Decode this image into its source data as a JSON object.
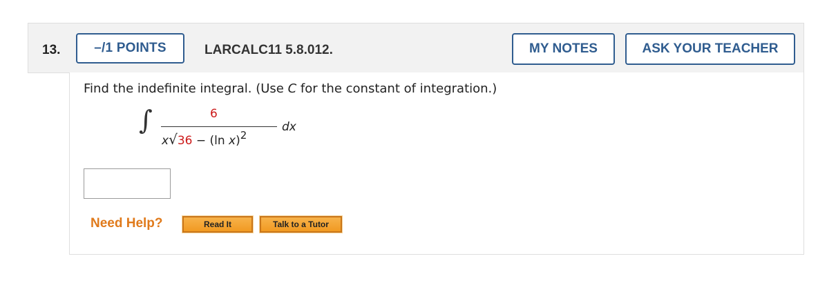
{
  "question": {
    "number": "13.",
    "points_label": "–/1 POINTS",
    "problem_id": "LARCALC11 5.8.012.",
    "my_notes_label": "MY NOTES",
    "ask_teacher_label": "ASK YOUR TEACHER"
  },
  "body": {
    "prompt_before": "Find the indefinite integral. (Use ",
    "prompt_var": "C",
    "prompt_after": " for the constant of integration.)",
    "integral": {
      "sign": "∫",
      "numerator": "6",
      "denom_x": "x",
      "radical": "√",
      "denom_const": "36",
      "denom_minus": " − (ln ",
      "denom_x2": "x",
      "denom_close": ")",
      "exponent": "2",
      "differential": "dx"
    },
    "answer_value": ""
  },
  "help": {
    "label": "Need Help?",
    "read_it": "Read It",
    "talk_tutor": "Talk to a Tutor"
  },
  "colors": {
    "accent_blue": "#2f5c8f",
    "highlight_red": "#cc1a1a",
    "help_orange": "#e07a1b",
    "button_orange": "#f19a22"
  }
}
